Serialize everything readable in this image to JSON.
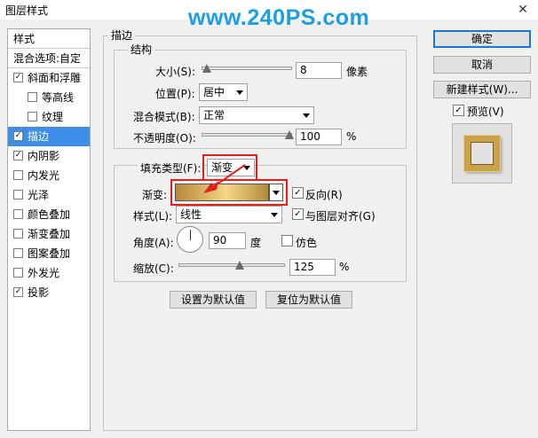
{
  "window": {
    "title": "图层样式",
    "close_glyph": "✕"
  },
  "watermark": "www.240PS.com",
  "left_list": {
    "header": "样式",
    "blend_options": "混合选项:自定",
    "items": [
      {
        "label": "斜面和浮雕",
        "checked": true,
        "indent": 0
      },
      {
        "label": "等高线",
        "checked": false,
        "indent": 1
      },
      {
        "label": "纹理",
        "checked": false,
        "indent": 1
      },
      {
        "label": "描边",
        "checked": true,
        "indent": 0,
        "selected": true
      },
      {
        "label": "内阴影",
        "checked": true,
        "indent": 0
      },
      {
        "label": "内发光",
        "checked": false,
        "indent": 0
      },
      {
        "label": "光泽",
        "checked": false,
        "indent": 0
      },
      {
        "label": "颜色叠加",
        "checked": false,
        "indent": 0
      },
      {
        "label": "渐变叠加",
        "checked": false,
        "indent": 0
      },
      {
        "label": "图案叠加",
        "checked": false,
        "indent": 0
      },
      {
        "label": "外发光",
        "checked": false,
        "indent": 0
      },
      {
        "label": "投影",
        "checked": true,
        "indent": 0
      }
    ]
  },
  "stroke": {
    "section_title": "描边",
    "structure_title": "结构",
    "size_label": "大小(S):",
    "size_value": "8",
    "size_unit": "像素",
    "size_level": 0.05,
    "position_label": "位置(P):",
    "position_value": "居中",
    "blend_mode_label": "混合模式(B):",
    "blend_mode_value": "正常",
    "opacity_label": "不透明度(O):",
    "opacity_value": "100",
    "opacity_unit": "%",
    "opacity_level": 1.0,
    "fill_type_label": "填充类型(F):",
    "fill_type_value": "渐变",
    "gradient_label": "渐变:",
    "reverse_label": "反向(R)",
    "reverse_checked": true,
    "style_label": "样式(L):",
    "style_value": "线性",
    "align_label": "与图层对齐(G)",
    "align_checked": true,
    "angle_label": "角度(A):",
    "angle_value": "90",
    "angle_unit": "度",
    "dither_label": "仿色",
    "dither_checked": false,
    "scale_label": "缩放(C):",
    "scale_value": "125",
    "scale_unit": "%",
    "scale_level": 0.59,
    "set_default_button": "设置为默认值",
    "reset_default_button": "复位为默认值"
  },
  "right_buttons": {
    "ok": "确定",
    "cancel": "取消",
    "new_style": "新建样式(W)...",
    "preview_label": "预览(V)",
    "preview_checked": true
  },
  "colors": {
    "selected_row": "#3d8ee8",
    "annotation_red": "#e0201c",
    "gradient_start": "#b8873a",
    "gradient_mid": "#f3d887",
    "gradient_end": "#b48a3c"
  }
}
